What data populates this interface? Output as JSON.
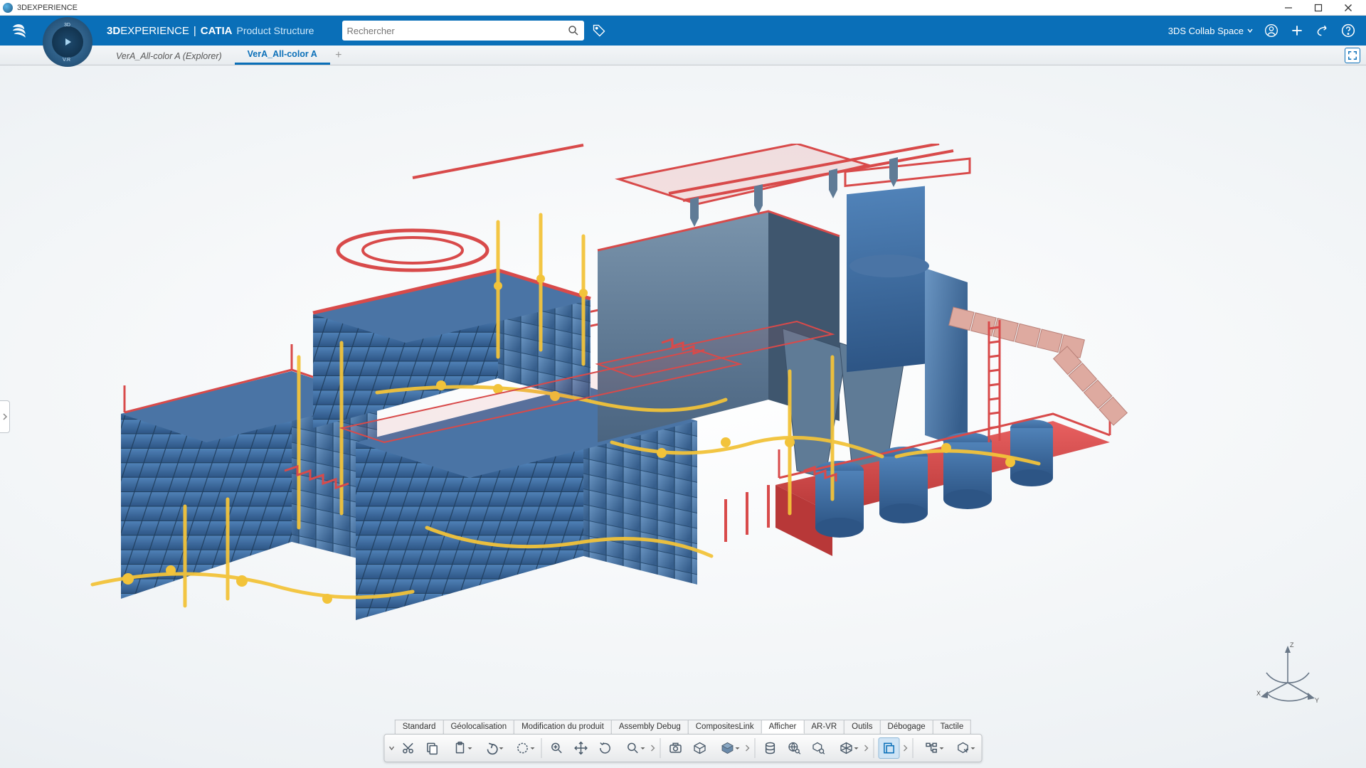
{
  "window": {
    "title": "3DEXPERIENCE"
  },
  "header": {
    "brand_bold": "3D",
    "brand_rest": "EXPERIENCE",
    "brand_sep": " | ",
    "brand_app": "CATIA",
    "brand_sub": "Product Structure",
    "compass": {
      "top": "3D",
      "bottom": "V.R"
    },
    "search_placeholder": "Rechercher",
    "space_label": "3DS Collab Space"
  },
  "tabs": [
    {
      "label": "VerA_All-color A (Explorer)",
      "active": false
    },
    {
      "label": "VerA_All-color A",
      "active": true
    }
  ],
  "axis": {
    "x": "X",
    "y": "Y",
    "z": "Z"
  },
  "bottom_tabs": [
    {
      "label": "Standard",
      "active": false
    },
    {
      "label": "Géolocalisation",
      "active": false
    },
    {
      "label": "Modification du produit",
      "active": false
    },
    {
      "label": "Assembly Debug",
      "active": false
    },
    {
      "label": "CompositesLink",
      "active": false
    },
    {
      "label": "Afficher",
      "active": true
    },
    {
      "label": "AR-VR",
      "active": false
    },
    {
      "label": "Outils",
      "active": false
    },
    {
      "label": "Débogage",
      "active": false
    },
    {
      "label": "Tactile",
      "active": false
    }
  ],
  "colors": {
    "blue_eq": "#3a6ca3",
    "red_struct": "#d84a4a",
    "yellow_pipe": "#f2c33a",
    "pink_duct": "#deaaa0",
    "steel": "#5f7b96"
  }
}
